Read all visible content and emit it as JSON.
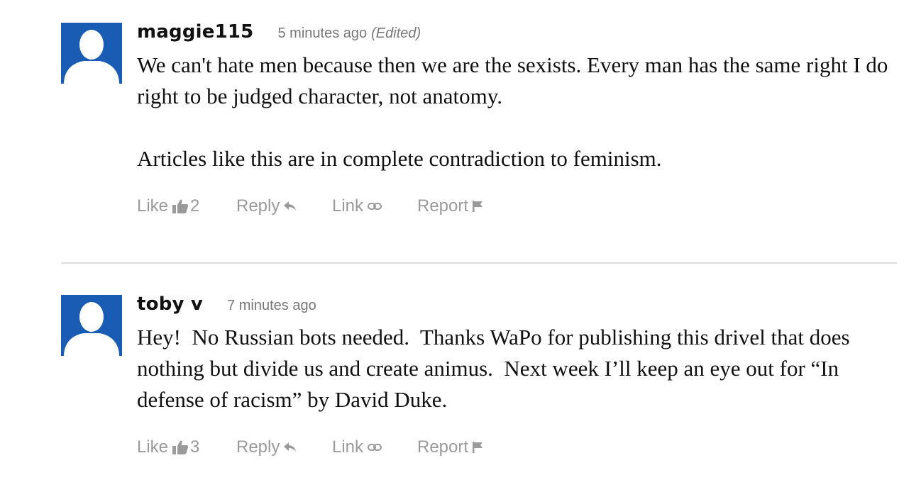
{
  "comments": [
    {
      "username": "maggie115",
      "timestamp": "5 minutes ago",
      "edited_label": "(Edited)",
      "paragraphs": [
        "We can't hate men because then we are the sexists. Every man has the same right I do right to be judged character, not anatomy.",
        "Articles like this are in complete contradiction to feminism."
      ],
      "like_label": "Like",
      "like_count": "2",
      "reply_label": "Reply",
      "link_label": "Link",
      "report_label": "Report"
    },
    {
      "username": "toby v",
      "timestamp": "7 minutes ago",
      "paragraphs": [
        "Hey!  No Russian bots needed.  Thanks WaPo for publishing this drivel that does nothing but divide us and create animus.  Next week I’ll keep an eye out for “In defense of racism” by David Duke."
      ],
      "like_label": "Like",
      "like_count": "3",
      "reply_label": "Reply",
      "link_label": "Link",
      "report_label": "Report"
    }
  ],
  "colors": {
    "avatar_bg": "#1a5cb3",
    "avatar_silhouette": "#ffffff",
    "text": "#111111",
    "muted": "#9a9a9a",
    "divider": "#dcdcdc"
  },
  "icons": {
    "avatar": "user-silhouette-icon",
    "like": "thumbs-up-icon",
    "reply": "reply-arrow-icon",
    "link": "chain-link-icon",
    "report": "flag-icon"
  }
}
